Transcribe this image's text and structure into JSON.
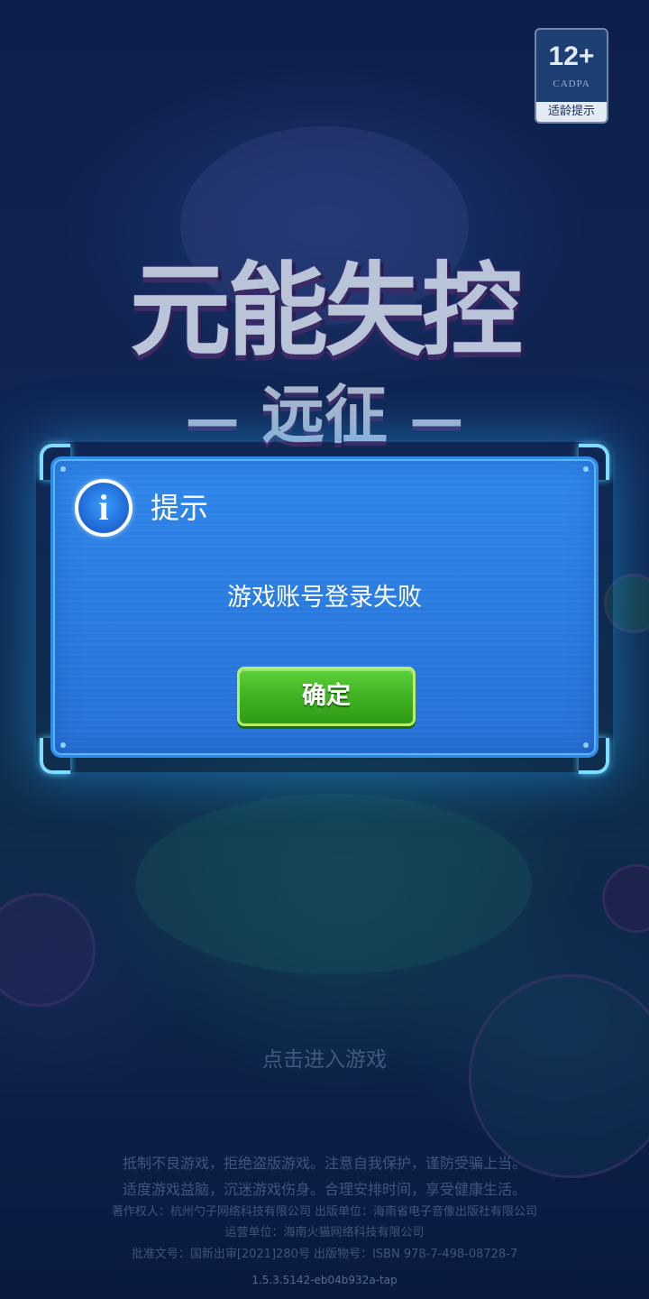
{
  "age_rating": {
    "number": "12+",
    "org": "CADPA",
    "label": "适龄提示"
  },
  "logo": {
    "title": "元能失控",
    "subtitle": "远征",
    "dash_left": "—",
    "dash_right": "—"
  },
  "dialog": {
    "icon": "info-icon",
    "icon_glyph": "i",
    "title": "提示",
    "message": "游戏账号登录失败",
    "confirm_label": "确定"
  },
  "tap_to_enter": "点击进入游戏",
  "footer": {
    "line1": "抵制不良游戏，拒绝盗版游戏。注意自我保护，谨防受骗上当。",
    "line2": "适度游戏益脑，沉迷游戏伤身。合理安排时间，享受健康生活。",
    "line3": "著作权人：杭州勺子网络科技有限公司 出版单位：海南省电子音像出版社有限公司",
    "line4": "运营单位：海南火猫网络科技有限公司",
    "line5": "批准文号：国新出审[2021]280号 出版物号：ISBN 978-7-498-08728-7",
    "version": "1.5.3.5142-eb04b932a-tap"
  },
  "colors": {
    "dialog_bg": "#2a7be0",
    "dialog_border": "#2f8be8",
    "confirm_button": "#3eb021",
    "background": "#13285c"
  }
}
